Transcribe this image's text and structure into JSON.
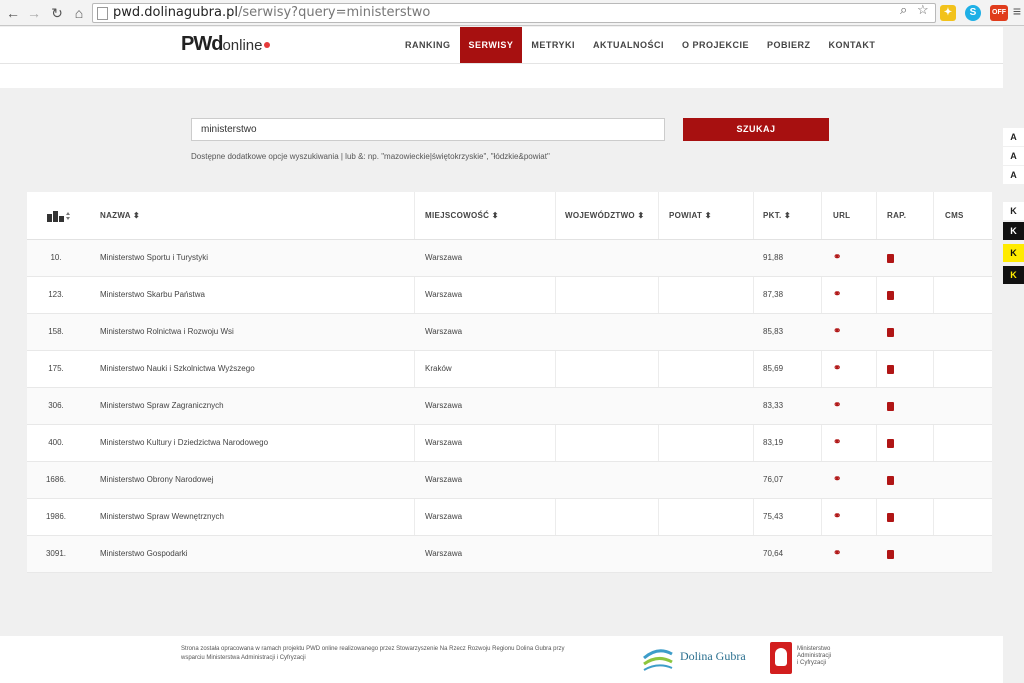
{
  "browser": {
    "url_host": "pwd.dolinagubra.pl",
    "url_path": "/serwisy?query=ministerstwo",
    "ext_off_label": "OFF"
  },
  "site": {
    "logo_main": "PWd",
    "logo_sub": "online",
    "menu": [
      {
        "label": "RANKING"
      },
      {
        "label": "SERWISY"
      },
      {
        "label": "METRYKI"
      },
      {
        "label": "AKTUALNOŚCI"
      },
      {
        "label": "O PROJEKCIE"
      },
      {
        "label": "POBIERZ"
      },
      {
        "label": "KONTAKT"
      }
    ]
  },
  "search": {
    "value": "ministerstwo",
    "button_label": "SZUKAJ",
    "hint": "Dostępne dodatkowe opcje wyszukiwania | lub &: np. \"mazowieckie|świętokrzyskie\", \"łódzkie&powiat\""
  },
  "accessibility": {
    "font_a1": "A",
    "font_a2": "A",
    "font_a3": "A",
    "contrast_k1": "K",
    "contrast_k2": "K",
    "contrast_k3": "K",
    "contrast_k4": "K"
  },
  "table": {
    "headers": {
      "nazwa": "NAZWA ⬍",
      "miejscowosc": "MIEJSCOWOŚĆ ⬍",
      "wojewodztwo": "WOJEWÓDZTWO ⬍",
      "powiat": "POWIAT ⬍",
      "pkt": "PKT. ⬍",
      "url": "URL",
      "rap": "RAP.",
      "cms": "CMS"
    },
    "rows": [
      {
        "rank": "10.",
        "name": "Ministerstwo Sportu i Turystyki",
        "city": "Warszawa",
        "score": "91,88"
      },
      {
        "rank": "123.",
        "name": "Ministerstwo Skarbu Państwa",
        "city": "Warszawa",
        "score": "87,38"
      },
      {
        "rank": "158.",
        "name": "Ministerstwo Rolnictwa i Rozwoju Wsi",
        "city": "Warszawa",
        "score": "85,83"
      },
      {
        "rank": "175.",
        "name": "Ministerstwo Nauki i Szkolnictwa Wyższego",
        "city": "Kraków",
        "score": "85,69"
      },
      {
        "rank": "306.",
        "name": "Ministerstwo Spraw Zagranicznych",
        "city": "Warszawa",
        "score": "83,33"
      },
      {
        "rank": "400.",
        "name": "Ministerstwo Kultury i Dziedzictwa Narodowego",
        "city": "Warszawa",
        "score": "83,19"
      },
      {
        "rank": "1686.",
        "name": "Ministerstwo Obrony Narodowej",
        "city": "Warszawa",
        "score": "76,07"
      },
      {
        "rank": "1986.",
        "name": "Ministerstwo Spraw Wewnętrznych",
        "city": "Warszawa",
        "score": "75,43"
      },
      {
        "rank": "3091.",
        "name": "Ministerstwo Gospodarki",
        "city": "Warszawa",
        "score": "70,64"
      }
    ]
  },
  "footer": {
    "text": "Strona została opracowana w ramach projektu PWD online realizowanego przez Stowarzyszenie Na Rzecz Rozwoju Regionu Dolina Gubra przy wsparciu Ministerstwa Administracji i Cyfryzacji",
    "dg_name": "Dolina Gubra",
    "ministry_line1": "Ministerstwo",
    "ministry_line2": "Administracji",
    "ministry_line3": "i Cyfryzacji"
  },
  "colors": {
    "accent": "#a71010",
    "link_icon": "#b01515"
  }
}
